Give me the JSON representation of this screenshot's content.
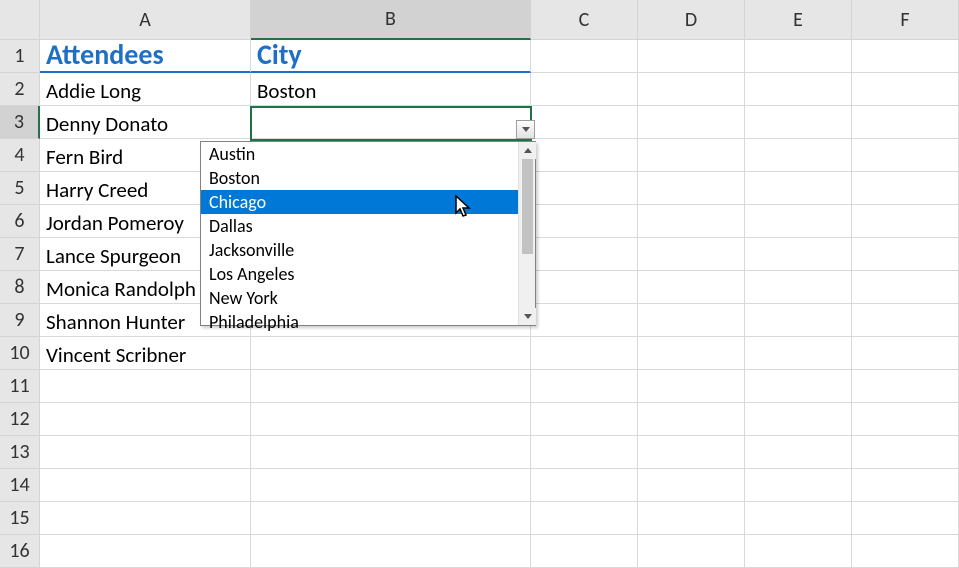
{
  "columns": [
    "A",
    "B",
    "C",
    "D",
    "E",
    "F"
  ],
  "rows": [
    1,
    2,
    3,
    4,
    5,
    6,
    7,
    8,
    9,
    10,
    11,
    12,
    13,
    14,
    15,
    16
  ],
  "active_column_index": 1,
  "active_row_index": 2,
  "headers": {
    "A": "Attendees",
    "B": "City"
  },
  "data": {
    "A2": "Addie Long",
    "A3": "Denny Donato",
    "A4": "Fern Bird",
    "A5": "Harry Creed",
    "A6": "Jordan Pomeroy",
    "A7": "Lance Spurgeon",
    "A8": "Monica Randolph",
    "A9": "Shannon Hunter",
    "A10": "Vincent Scribner",
    "B2": "Boston",
    "B3": ""
  },
  "dropdown": {
    "visible": true,
    "items": [
      "Austin",
      "Boston",
      "Chicago",
      "Dallas",
      "Jacksonville",
      "Los Angeles",
      "New York",
      "Philadelphia"
    ],
    "highlighted_index": 2
  },
  "selected_cell": "B3"
}
